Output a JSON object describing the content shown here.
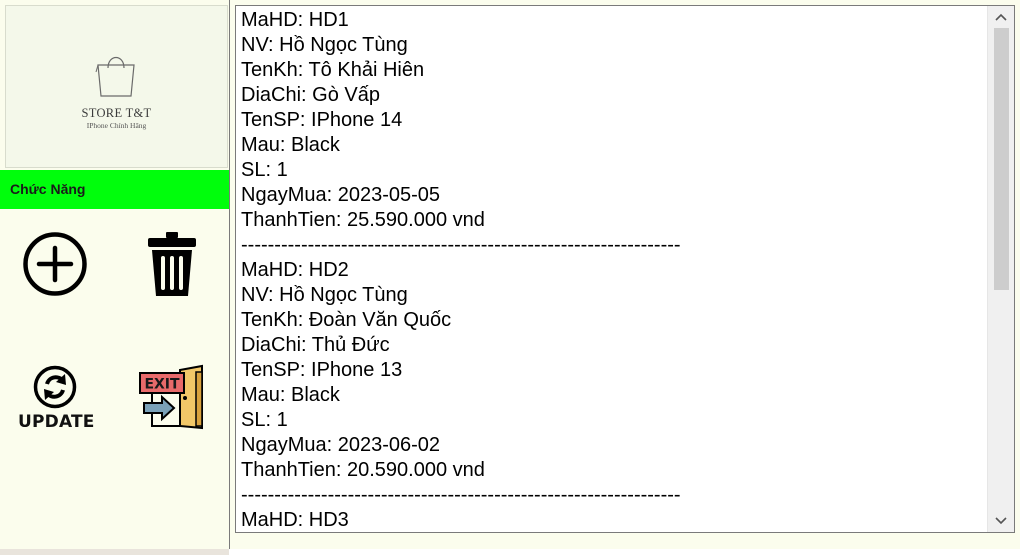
{
  "logo": {
    "title": "STORE T&T",
    "subtitle": "IPhone Chính Hãng"
  },
  "functions": {
    "label": "Chức Năng",
    "update_label": "UPDATE",
    "exit_sign": "EXIT"
  },
  "records": [
    "MaHD: HD1",
    "NV: Hồ Ngọc Tùng",
    "TenKh: Tô Khải Hiên",
    "DiaChi: Gò Vấp",
    "TenSP: IPhone 14",
    "Mau: Black",
    "SL: 1",
    "NgayMua: 2023-05-05",
    "ThanhTien: 25.590.000 vnd",
    "------------------------------------------------------------------",
    "MaHD: HD2",
    "NV: Hồ Ngọc Tùng",
    "TenKh: Đoàn Văn Quốc",
    "DiaChi: Thủ Đức",
    "TenSP: IPhone 13",
    "Mau: Black",
    "SL: 1",
    "NgayMua: 2023-06-02",
    "ThanhTien: 20.590.000 vnd",
    "------------------------------------------------------------------",
    "MaHD: HD3"
  ],
  "colors": {
    "function_bar": "#00fe0c",
    "panel_bg": "#fbfded",
    "exit_sign": "#e86a6a",
    "door": "#f1c768"
  },
  "icons": [
    "plus-circle-icon",
    "trash-icon",
    "refresh-icon",
    "exit-door-icon",
    "shopping-bag-icon"
  ]
}
